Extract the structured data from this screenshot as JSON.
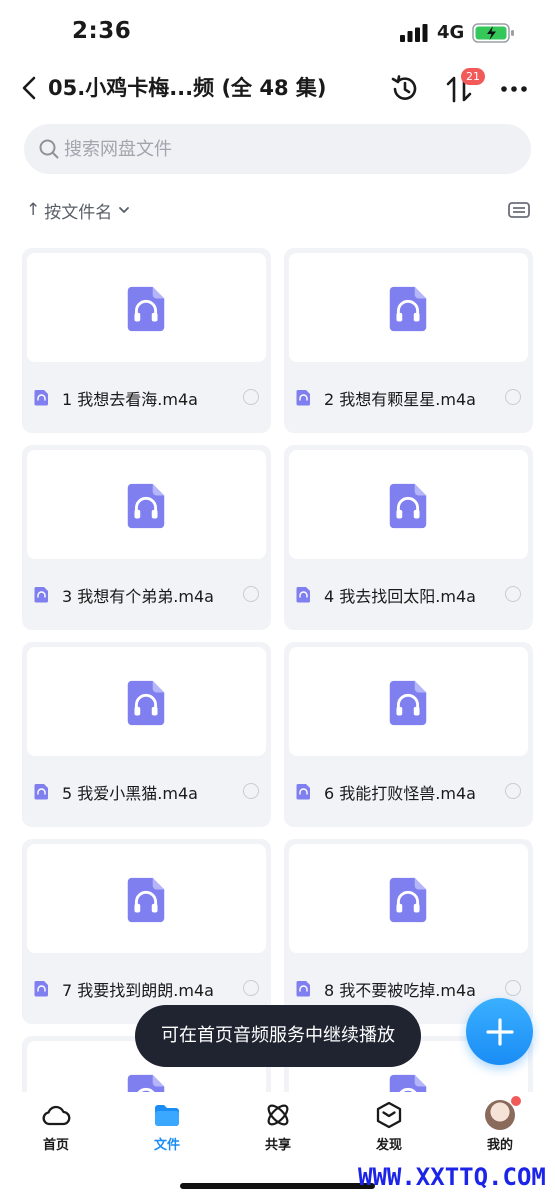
{
  "status_bar": {
    "time": "2:36",
    "network": "4G"
  },
  "header": {
    "title": "05.小鸡卡梅...频 (全 48 集)",
    "transfer_badge": "21"
  },
  "search": {
    "placeholder": "搜索网盘文件"
  },
  "sort": {
    "label": "按文件名"
  },
  "files": [
    {
      "name": "1 我想去看海.m4a"
    },
    {
      "name": "2 我想有颗星星.m4a"
    },
    {
      "name": "3 我想有个弟弟.m4a"
    },
    {
      "name": "4 我去找回太阳.m4a"
    },
    {
      "name": "5 我爱小黑猫.m4a"
    },
    {
      "name": "6 我能打败怪兽.m4a"
    },
    {
      "name": "7 我要找到朗朗.m4a"
    },
    {
      "name": "8 我不要被吃掉.m4a"
    },
    {
      "name": ""
    },
    {
      "name": ""
    }
  ],
  "toast": {
    "message": "可在首页音频服务中继续播放"
  },
  "bottom_nav": {
    "items": [
      {
        "label": "首页",
        "icon": "cloud-home-icon"
      },
      {
        "label": "文件",
        "icon": "folder-icon"
      },
      {
        "label": "共享",
        "icon": "share-atom-icon"
      },
      {
        "label": "发现",
        "icon": "discover-cube-icon"
      },
      {
        "label": "我的",
        "icon": "avatar"
      }
    ]
  },
  "watermark": "WWW.XXTTQ.COM",
  "colors": {
    "accent": "#1a8cf5",
    "audio_icon": "#7f7ff0",
    "badge": "#f25a5a",
    "toast_bg": "#1f2430"
  }
}
